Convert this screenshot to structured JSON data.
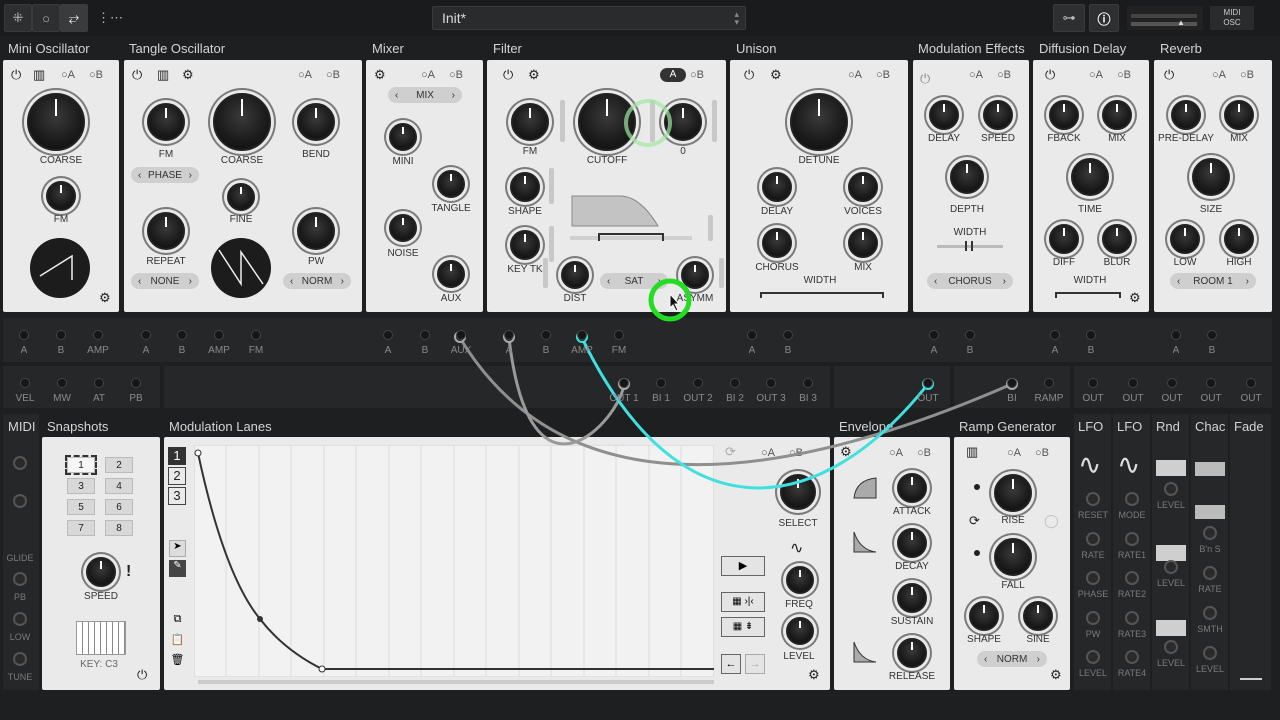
{
  "topbar": {
    "preset_name": "Init*",
    "midi_osc": "MIDI\nOSC"
  },
  "modules": {
    "mini_oscillator": {
      "title": "Mini Oscillator",
      "coarse": "COARSE",
      "fm": "FM"
    },
    "tangle_oscillator": {
      "title": "Tangle Oscillator",
      "fm": "FM",
      "coarse": "COARSE",
      "bend": "BEND",
      "phase": "PHASE",
      "fine": "FINE",
      "repeat": "REPEAT",
      "pw": "PW",
      "none": "NONE",
      "norm": "NORM"
    },
    "mixer": {
      "title": "Mixer",
      "mix": "MIX",
      "mini": "MINI",
      "tangle": "TANGLE",
      "noise": "NOISE",
      "aux": "AUX"
    },
    "filter": {
      "title": "Filter",
      "fm": "FM",
      "cutoff": "CUTOFF",
      "zero": "0",
      "shape": "SHAPE",
      "key_tk": "KEY TK",
      "dist": "DIST",
      "sat": "SAT",
      "asymm": "ASYMM",
      "a": "A",
      "b": "B"
    },
    "unison": {
      "title": "Unison",
      "detune": "DETUNE",
      "delay": "DELAY",
      "voices": "VOICES",
      "chorus": "CHORUS",
      "mix": "MIX",
      "width": "WIDTH"
    },
    "modulation_effects": {
      "title": "Modulation Effects",
      "delay": "DELAY",
      "speed": "SPEED",
      "depth": "DEPTH",
      "width": "WIDTH",
      "chorus": "CHORUS"
    },
    "diffusion_delay": {
      "title": "Diffusion Delay",
      "fback": "FBACK",
      "mix": "MIX",
      "time": "TIME",
      "diff": "DIFF",
      "blur": "BLUR",
      "width": "WIDTH"
    },
    "reverb": {
      "title": "Reverb",
      "pre_delay": "PRE-DELAY",
      "mix": "MIX",
      "size": "SIZE",
      "low": "LOW",
      "high": "HIGH",
      "room": "ROOM 1"
    }
  },
  "ab": {
    "a": "A",
    "b": "B"
  },
  "jacks_row1": {
    "mini": [
      "A",
      "B",
      "AMP"
    ],
    "tangle": [
      "A",
      "B",
      "AMP",
      "FM"
    ],
    "mixer": [
      "A",
      "B",
      "AUX"
    ],
    "filter": [
      "A",
      "B",
      "AMP",
      "FM"
    ],
    "unison": [
      "A",
      "B"
    ],
    "modfx": [
      "A",
      "B"
    ],
    "delay": [
      "A",
      "B"
    ],
    "reverb": [
      "A",
      "B"
    ]
  },
  "jacks_row2": {
    "left": [
      "VEL",
      "MW",
      "AT",
      "PB"
    ],
    "lanes": [
      "OUT 1",
      "BI 1",
      "OUT 2",
      "BI 2",
      "OUT 3",
      "BI 3"
    ],
    "env": "OUT",
    "ramp": [
      "BI",
      "RAMP"
    ],
    "lfos": [
      "OUT",
      "OUT",
      "OUT",
      "OUT",
      "OUT"
    ]
  },
  "bottom": {
    "midi": {
      "title": "MIDI",
      "labels": [
        "GLIDE",
        "PB",
        "LOW",
        "TUNE"
      ]
    },
    "snapshots": {
      "title": "Snapshots",
      "nums": [
        "1",
        "2",
        "3",
        "4",
        "5",
        "6",
        "7",
        "8"
      ],
      "speed": "SPEED",
      "key": "KEY: C3"
    },
    "lanes": {
      "title": "Modulation Lanes",
      "tabs": [
        "1",
        "2",
        "3"
      ],
      "select": "SELECT",
      "freq": "FREQ",
      "level": "LEVEL"
    },
    "envelope": {
      "title": "Envelope",
      "attack": "ATTACK",
      "decay": "DECAY",
      "sustain": "SUSTAIN",
      "release": "RELEASE"
    },
    "ramp": {
      "title": "Ramp Generator",
      "rise": "RISE",
      "fall": "FALL",
      "shape": "SHAPE",
      "sine": "SINE",
      "norm": "NORM"
    },
    "lfo1": {
      "title": "LFO",
      "labels": [
        "RESET",
        "RATE",
        "PHASE",
        "PW",
        "LEVEL"
      ]
    },
    "lfo2": {
      "title": "LFO",
      "labels": [
        "MODE",
        "RATE1",
        "RATE2",
        "RATE3",
        "RATE4"
      ]
    },
    "rnd": {
      "title": "Rnd",
      "labels": [
        "LEVEL",
        "LEVEL",
        "LEVEL"
      ]
    },
    "chaos": {
      "title": "Chac",
      "labels": [
        "B'n S",
        "RATE",
        "SMTH",
        "LEVEL"
      ]
    },
    "fade": {
      "title": "Fade"
    }
  },
  "colors": {
    "cable_cyan": "#3fe0e0",
    "cable_gray": "#8a8a8a",
    "cursor_green": "#22dd22"
  }
}
